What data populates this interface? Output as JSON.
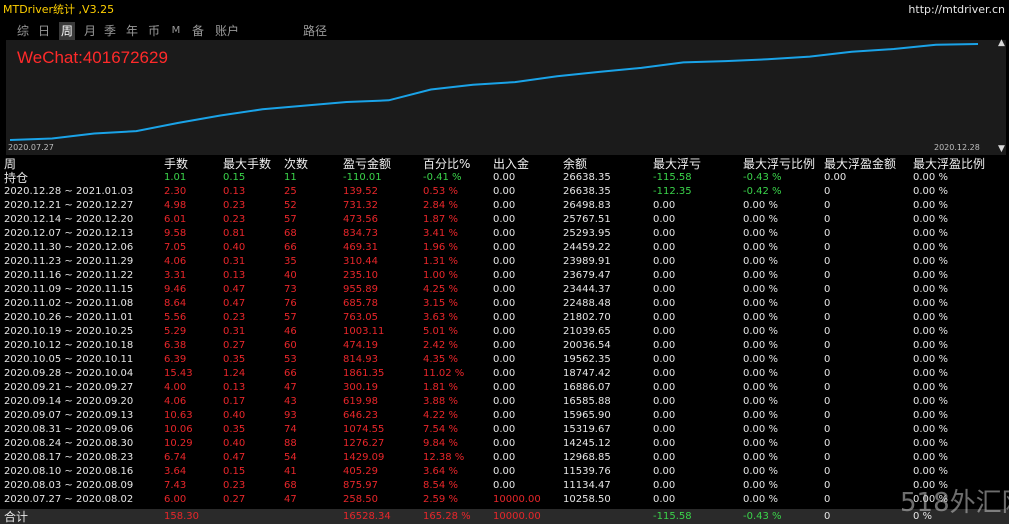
{
  "window": {
    "title": "MTDriver统计 ,V3.25",
    "site": "http://mtdriver.cn"
  },
  "tabs": [
    {
      "label": "综"
    },
    {
      "label": "日"
    },
    {
      "label": "周"
    },
    {
      "label": "月"
    },
    {
      "label": "季"
    },
    {
      "label": "年"
    },
    {
      "label": "币"
    },
    {
      "label": "M"
    },
    {
      "label": "备"
    },
    {
      "label": "账户"
    },
    {
      "label": "路径"
    }
  ],
  "active_tab": "周",
  "chart": {
    "watermark": "WeChat:401672629",
    "date_start": "2020.07.27",
    "date_end": "2020.12.28",
    "line_color": "#1aa3e8",
    "series": [
      10000.0,
      10258.5,
      11134.47,
      11539.76,
      12968.85,
      14245.12,
      15319.67,
      15965.9,
      16585.88,
      16886.07,
      18747.42,
      19562.35,
      20036.54,
      21039.65,
      21802.7,
      22488.48,
      23444.37,
      23679.47,
      23989.91,
      24459.22,
      25293.95,
      25767.51,
      26498.83,
      26638.35
    ]
  },
  "scroll": {
    "up": "▲",
    "down": "▼"
  },
  "table": {
    "headers": [
      "周",
      "手数",
      "最大手数",
      "次数",
      "盈亏金额",
      "百分比%",
      "出入金",
      "余额",
      "最大浮亏",
      "最大浮亏比例",
      "最大浮盈金额",
      "最大浮盈比例"
    ],
    "rows": [
      [
        "持仓",
        "1.01",
        "0.15",
        "11",
        "-110.01",
        "-0.41 %",
        "0.00",
        "26638.35",
        "-115.58",
        "-0.43 %",
        "0.00",
        "0.00 %"
      ],
      [
        "2020.12.28 ~ 2021.01.03",
        "2.30",
        "0.13",
        "25",
        "139.52",
        "0.53 %",
        "0.00",
        "26638.35",
        "-112.35",
        "-0.42 %",
        "0",
        "0.00 %"
      ],
      [
        "2020.12.21 ~ 2020.12.27",
        "4.98",
        "0.23",
        "52",
        "731.32",
        "2.84 %",
        "0.00",
        "26498.83",
        "0.00",
        "0.00 %",
        "0",
        "0.00 %"
      ],
      [
        "2020.12.14 ~ 2020.12.20",
        "6.01",
        "0.23",
        "57",
        "473.56",
        "1.87 %",
        "0.00",
        "25767.51",
        "0.00",
        "0.00 %",
        "0",
        "0.00 %"
      ],
      [
        "2020.12.07 ~ 2020.12.13",
        "9.58",
        "0.81",
        "68",
        "834.73",
        "3.41 %",
        "0.00",
        "25293.95",
        "0.00",
        "0.00 %",
        "0",
        "0.00 %"
      ],
      [
        "2020.11.30 ~ 2020.12.06",
        "7.05",
        "0.40",
        "66",
        "469.31",
        "1.96 %",
        "0.00",
        "24459.22",
        "0.00",
        "0.00 %",
        "0",
        "0.00 %"
      ],
      [
        "2020.11.23 ~ 2020.11.29",
        "4.06",
        "0.31",
        "35",
        "310.44",
        "1.31 %",
        "0.00",
        "23989.91",
        "0.00",
        "0.00 %",
        "0",
        "0.00 %"
      ],
      [
        "2020.11.16 ~ 2020.11.22",
        "3.31",
        "0.13",
        "40",
        "235.10",
        "1.00 %",
        "0.00",
        "23679.47",
        "0.00",
        "0.00 %",
        "0",
        "0.00 %"
      ],
      [
        "2020.11.09 ~ 2020.11.15",
        "9.46",
        "0.47",
        "73",
        "955.89",
        "4.25 %",
        "0.00",
        "23444.37",
        "0.00",
        "0.00 %",
        "0",
        "0.00 %"
      ],
      [
        "2020.11.02 ~ 2020.11.08",
        "8.64",
        "0.47",
        "76",
        "685.78",
        "3.15 %",
        "0.00",
        "22488.48",
        "0.00",
        "0.00 %",
        "0",
        "0.00 %"
      ],
      [
        "2020.10.26 ~ 2020.11.01",
        "5.56",
        "0.23",
        "57",
        "763.05",
        "3.63 %",
        "0.00",
        "21802.70",
        "0.00",
        "0.00 %",
        "0",
        "0.00 %"
      ],
      [
        "2020.10.19 ~ 2020.10.25",
        "5.29",
        "0.31",
        "46",
        "1003.11",
        "5.01 %",
        "0.00",
        "21039.65",
        "0.00",
        "0.00 %",
        "0",
        "0.00 %"
      ],
      [
        "2020.10.12 ~ 2020.10.18",
        "6.38",
        "0.27",
        "60",
        "474.19",
        "2.42 %",
        "0.00",
        "20036.54",
        "0.00",
        "0.00 %",
        "0",
        "0.00 %"
      ],
      [
        "2020.10.05 ~ 2020.10.11",
        "6.39",
        "0.35",
        "53",
        "814.93",
        "4.35 %",
        "0.00",
        "19562.35",
        "0.00",
        "0.00 %",
        "0",
        "0.00 %"
      ],
      [
        "2020.09.28 ~ 2020.10.04",
        "15.43",
        "1.24",
        "66",
        "1861.35",
        "11.02 %",
        "0.00",
        "18747.42",
        "0.00",
        "0.00 %",
        "0",
        "0.00 %"
      ],
      [
        "2020.09.21 ~ 2020.09.27",
        "4.00",
        "0.13",
        "47",
        "300.19",
        "1.81 %",
        "0.00",
        "16886.07",
        "0.00",
        "0.00 %",
        "0",
        "0.00 %"
      ],
      [
        "2020.09.14 ~ 2020.09.20",
        "4.06",
        "0.17",
        "43",
        "619.98",
        "3.88 %",
        "0.00",
        "16585.88",
        "0.00",
        "0.00 %",
        "0",
        "0.00 %"
      ],
      [
        "2020.09.07 ~ 2020.09.13",
        "10.63",
        "0.40",
        "93",
        "646.23",
        "4.22 %",
        "0.00",
        "15965.90",
        "0.00",
        "0.00 %",
        "0",
        "0.00 %"
      ],
      [
        "2020.08.31 ~ 2020.09.06",
        "10.06",
        "0.35",
        "74",
        "1074.55",
        "7.54 %",
        "0.00",
        "15319.67",
        "0.00",
        "0.00 %",
        "0",
        "0.00 %"
      ],
      [
        "2020.08.24 ~ 2020.08.30",
        "10.29",
        "0.40",
        "88",
        "1276.27",
        "9.84 %",
        "0.00",
        "14245.12",
        "0.00",
        "0.00 %",
        "0",
        "0.00 %"
      ],
      [
        "2020.08.17 ~ 2020.08.23",
        "6.74",
        "0.47",
        "54",
        "1429.09",
        "12.38 %",
        "0.00",
        "12968.85",
        "0.00",
        "0.00 %",
        "0",
        "0.00 %"
      ],
      [
        "2020.08.10 ~ 2020.08.16",
        "3.64",
        "0.15",
        "41",
        "405.29",
        "3.64 %",
        "0.00",
        "11539.76",
        "0.00",
        "0.00 %",
        "0",
        "0.00 %"
      ],
      [
        "2020.08.03 ~ 2020.08.09",
        "7.43",
        "0.23",
        "68",
        "875.97",
        "8.54 %",
        "0.00",
        "11134.47",
        "0.00",
        "0.00 %",
        "0",
        "0.00 %"
      ],
      [
        "2020.07.27 ~ 2020.08.02",
        "6.00",
        "0.27",
        "47",
        "258.50",
        "2.59 %",
        "10000.00",
        "10258.50",
        "0.00",
        "0.00 %",
        "0",
        "0.00 %"
      ]
    ],
    "total": [
      "合计",
      "158.30",
      "",
      "",
      "16528.34",
      "165.28 %",
      "10000.00",
      "",
      "-115.58",
      "-0.43 %",
      "0",
      "0 %"
    ]
  },
  "colors": {
    "positive": "#e8262a",
    "negative": "#3ad34a",
    "neutral": "#e6e6e6",
    "header": "#f0f0f0"
  },
  "brand_watermark": "518外汇网"
}
